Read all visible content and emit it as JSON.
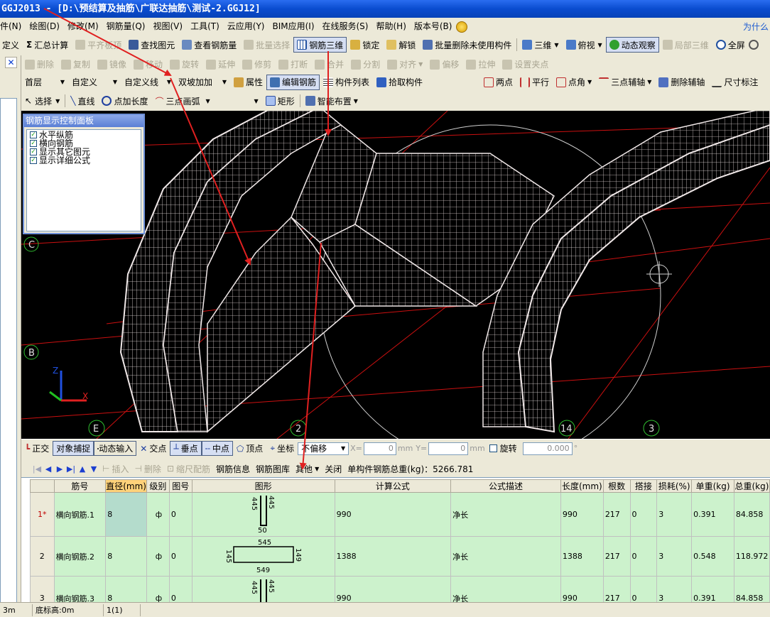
{
  "window": {
    "title": "GGJ2013 - [D:\\预结算及抽筋\\广联达抽筋\\测试-2.GGJ12]"
  },
  "menu": {
    "items": [
      "件(N)",
      "绘图(D)",
      "修改(M)",
      "钢筋量(Q)",
      "视图(V)",
      "工具(T)",
      "云应用(Y)",
      "BIM应用(I)",
      "在线服务(S)",
      "帮助(H)",
      "版本号(B)"
    ],
    "right_text": "为什么"
  },
  "toolbar1": [
    "定义",
    "汇总计算",
    "平齐板顶",
    "查找图元",
    "查看钢筋量",
    "批量选择",
    "钢筋三维",
    "锁定",
    "解锁",
    "批量删除未使用构件",
    "三维",
    "俯视",
    "动态观察",
    "局部三维",
    "全屏"
  ],
  "toolbar2": [
    "删除",
    "复制",
    "镜像",
    "移动",
    "旋转",
    "延伸",
    "修剪",
    "打断",
    "合并",
    "分割",
    "对齐",
    "偏移",
    "拉伸",
    "设置夹点"
  ],
  "toolbar2b": [
    "两点",
    "平行",
    "点角",
    "三点辅轴",
    "删除辅轴",
    "尺寸标注"
  ],
  "toolbar3": {
    "floor": "首层",
    "type": "自定义",
    "sub": "自定义线",
    "element": "双坡加加",
    "props": "属性",
    "edit_rebar": "编辑钢筋",
    "list": "构件列表",
    "pick": "拾取构件"
  },
  "toolbar4": {
    "select": "选择",
    "line": "直线",
    "point_len": "点加长度",
    "arc": "三点画弧",
    "rect": "矩形",
    "smart": "智能布置"
  },
  "panel": {
    "title": "钢筋显示控制面板",
    "items": [
      {
        "label": "水平纵筋",
        "checked": true
      },
      {
        "label": "横向钢筋",
        "checked": true
      },
      {
        "label": "显示其它图元",
        "checked": true
      },
      {
        "label": "显示详细公式",
        "checked": true
      }
    ]
  },
  "axes": {
    "labels": [
      "C",
      "B",
      "E",
      "2",
      "14",
      "3"
    ],
    "axis_z": "Z",
    "axis_x": "X"
  },
  "snapbar": {
    "ortho": "正交",
    "snap": "对象捕捉",
    "dyn": "动态输入",
    "inter": "交点",
    "perp": "垂点",
    "mid": "中点",
    "vertex": "顶点",
    "coord": "坐标",
    "offset": "不偏移",
    "x_label": "X=",
    "y_label": "Y=",
    "x_val": "0",
    "y_val": "0",
    "unit": "mm",
    "rotate": "旋转",
    "rotate_val": "0.000"
  },
  "rebarbar": {
    "insert": "插入",
    "delete": "删除",
    "scale": "缩尺配筋",
    "info": "钢筋信息",
    "library": "钢筋图库",
    "other": "其他",
    "close": "关闭",
    "total": "单构件钢筋总重(kg)：5266.781"
  },
  "table": {
    "headers": [
      "",
      "筋号",
      "直径(mm)",
      "级别",
      "图号",
      "图形",
      "计算公式",
      "公式描述",
      "长度(mm)",
      "根数",
      "搭接",
      "损耗(%)",
      "单重(kg)",
      "总重(kg)"
    ],
    "rows": [
      {
        "no": "1*",
        "name": "横向钢筋.1",
        "dia": "8",
        "grade": "ф",
        "fig": "0",
        "shape": {
          "a": "445",
          "b": "50",
          "c": "445"
        },
        "formula": "990",
        "desc": "净长",
        "len": "990",
        "count": "217",
        "lap": "0",
        "loss": "3",
        "unit_w": "0.391",
        "total_w": "84.858"
      },
      {
        "no": "2",
        "name": "横向钢筋.2",
        "dia": "8",
        "grade": "ф",
        "fig": "0",
        "shape": {
          "a": "145",
          "b": "545",
          "c": "149",
          "d": "549"
        },
        "formula": "1388",
        "desc": "净长",
        "len": "1388",
        "count": "217",
        "lap": "0",
        "loss": "3",
        "unit_w": "0.548",
        "total_w": "118.972"
      },
      {
        "no": "3",
        "name": "横向钢筋.3",
        "dia": "8",
        "grade": "ф",
        "fig": "0",
        "shape": {
          "a": "445",
          "b": "50",
          "c": "445"
        },
        "formula": "990",
        "desc": "净长",
        "len": "990",
        "count": "217",
        "lap": "0",
        "loss": "3",
        "unit_w": "0.391",
        "total_w": "84.858"
      }
    ]
  },
  "status": {
    "left": "3m",
    "bottom": "底标高:0m",
    "count": "1(1)"
  },
  "colors": {
    "title_bar": "#0a4ccf",
    "viewport_bg": "#000000",
    "rebar": "#e8dede",
    "grid_red": "#cc1010",
    "table_row": "#ccf2cc",
    "annot_red": "#e02020"
  }
}
